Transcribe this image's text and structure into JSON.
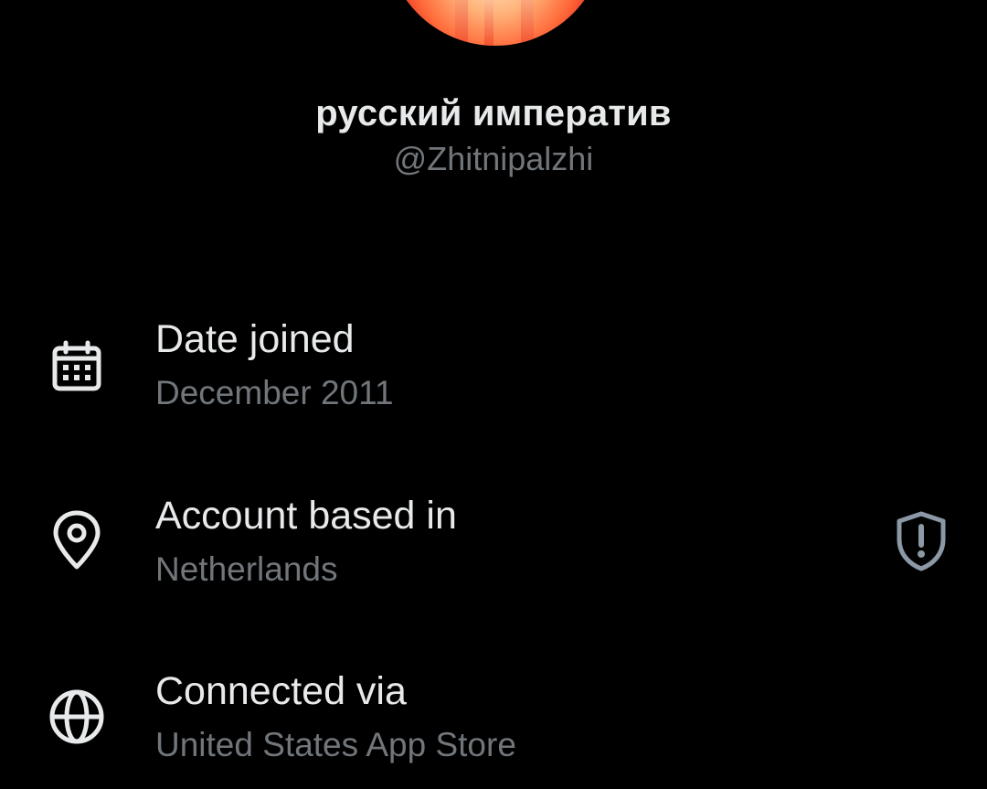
{
  "profile": {
    "display_name": "русский императив",
    "handle": "@Zhitnipalzhi"
  },
  "about_items": [
    {
      "icon": "calendar-icon",
      "title": "Date joined",
      "value": "December 2011"
    },
    {
      "icon": "location-pin-icon",
      "title": "Account based in",
      "value": "Netherlands",
      "trailing_icon": "shield-alert-icon"
    },
    {
      "icon": "globe-icon",
      "title": "Connected via",
      "value": "United States App Store"
    }
  ],
  "colors": {
    "background": "#000000",
    "primary_text": "#e7e9ea",
    "secondary_text": "#71767b",
    "icon": "#e7e9ea",
    "trailing_icon": "#8b98a5"
  }
}
